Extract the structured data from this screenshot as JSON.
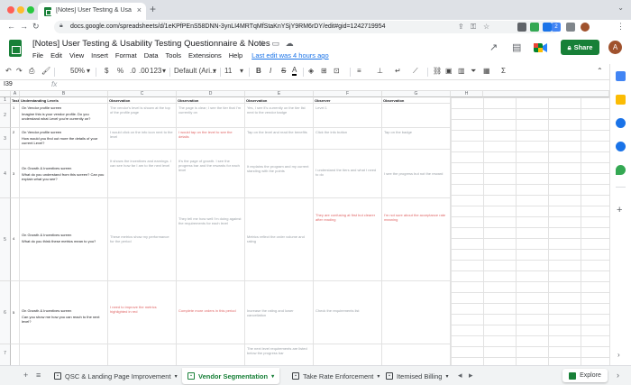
{
  "browser": {
    "tab_title": "[Notes] User Testing & Usabili",
    "url": "docs.google.com/spreadsheets/d/1eKPfPEnS58DNN-3ynLI4MRTqMfStaKnYSjY9RM6rDY/edit#gid=1242719954",
    "extension_badge": "2"
  },
  "doc": {
    "title": "[Notes] User Testing & Usability Testing Questionnaire & Notes",
    "last_edit": "Last edit was 4 hours ago",
    "share_label": "Share",
    "avatar_letter": "A"
  },
  "menu": [
    "File",
    "Edit",
    "View",
    "Insert",
    "Format",
    "Data",
    "Tools",
    "Extensions",
    "Help"
  ],
  "toolbar": {
    "zoom": "50%",
    "currency": "$",
    "percent": "%",
    "dec_decrease": ".0",
    "dec_increase": ".00",
    "more_formats": "123",
    "font": "Default (Ari...",
    "font_size": "11",
    "bold": "B",
    "italic": "I",
    "strike": "S",
    "text_color": "A"
  },
  "formula": {
    "namebox": "I39",
    "fx": "fx"
  },
  "grid": {
    "columns": [
      "",
      "A",
      "B",
      "C",
      "D",
      "E",
      "F",
      "G",
      "H"
    ],
    "header_row": {
      "row_num": "1",
      "task": "Task",
      "understanding": "Understanding Levels",
      "observations": [
        "Observation",
        "Observation",
        "Observation",
        "Observer",
        "Observation"
      ]
    },
    "rows": [
      {
        "num": "2",
        "task": "1",
        "heading": "On Vendor profile screen",
        "question": "Imagine this is your vendor profile. Do you understand what Level you're currently on?",
        "notes": [
          "The vendor's level is shown at the top of the profile page",
          "The page is clear; I see the tier that I'm currently on",
          "Yes, I see it's currently on the tier list next to the vendor badge",
          "Level 1",
          ""
        ]
      },
      {
        "num": "3",
        "task": "2",
        "heading": "On Vendor profile screen",
        "question": "How would you find out more the details of your current Level?",
        "notes": [
          "I would click on the info icon next to the level",
          "I would tap on the level to see the details",
          "Tap on the level and read the benefits",
          "Click the info button",
          "Tap on the badge"
        ]
      },
      {
        "num": "4",
        "task": "3",
        "heading": "On Growth & Incentives screen",
        "question": "What do you understand from this screen? Can you explain what you see?",
        "notes": [
          "It shows the incentives and earnings. I can see how far I am to the next level",
          "It's the page of growth. I see the progress bar and the rewards for each level",
          "It explains the program and my current standing with the points",
          "I understand the tiers and what I need to do",
          "I see the progress but not the reward"
        ]
      },
      {
        "num": "5",
        "task": "4",
        "heading": "On Growth & Incentives screen",
        "question": "What do you think these metrics mean to you?",
        "notes": [
          "These metrics show my performance for the period",
          "They tell me how well I'm doing against the requirements for each level",
          "Metrics reflect the order volume and rating",
          "They are confusing at first but clearer after reading",
          "I'm not sure about the acceptance rate meaning"
        ]
      },
      {
        "num": "6",
        "task": "5",
        "heading": "On Growth & Incentives screen",
        "question": "Can you show me how you can reach to the next level?",
        "notes": [
          "I need to improve the metrics highlighted in red",
          "Complete more orders in this period",
          "Increase the rating and lower cancellation",
          "Check the requirements list",
          ""
        ]
      },
      {
        "num": "7",
        "task": "",
        "heading": "",
        "question": "",
        "notes": [
          "",
          "",
          "The next level requirements are listed below the progress bar",
          "",
          ""
        ]
      }
    ]
  },
  "sheet_tabs": [
    "QSC & Landing Page Improvement",
    "Vendor Segmentation",
    "Take Rate Enforcement",
    "Itemised Billing"
  ],
  "explore_label": "Explore",
  "colors": {
    "sheets_green": "#188038",
    "link_blue": "#1a73e8",
    "note_red": "#e06666"
  }
}
